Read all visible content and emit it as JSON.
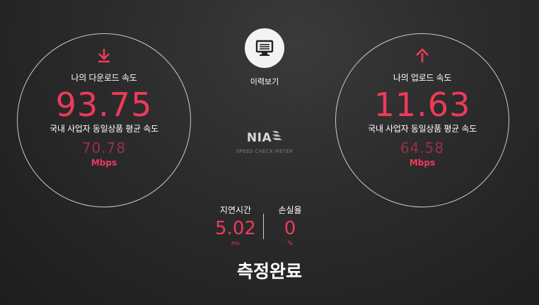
{
  "colors": {
    "accent": "#ee3a5a",
    "muted_accent": "#9a3048",
    "background": "#2b2b2b"
  },
  "download": {
    "icon": "arrow-down-icon",
    "title": "나의 다운로드 속도",
    "value": "93.75",
    "avg_label": "국내 사업자 동일상품 평균 속도",
    "avg_value": "70.78",
    "unit": "Mbps"
  },
  "upload": {
    "icon": "arrow-up-icon",
    "title": "나의 업로드 속도",
    "value": "11.63",
    "avg_label": "국내 사업자 동일상품 평균 속도",
    "avg_value": "64.58",
    "unit": "Mbps"
  },
  "history": {
    "icon": "monitor-icon",
    "label": "이력보기"
  },
  "logo": {
    "name": "NIA",
    "tagline": "SPEED CHECK METER"
  },
  "latency": {
    "label": "지연시간",
    "value": "5.02",
    "unit": "ms"
  },
  "loss": {
    "label": "손실율",
    "value": "0",
    "unit": "%"
  },
  "status": "측정완료"
}
